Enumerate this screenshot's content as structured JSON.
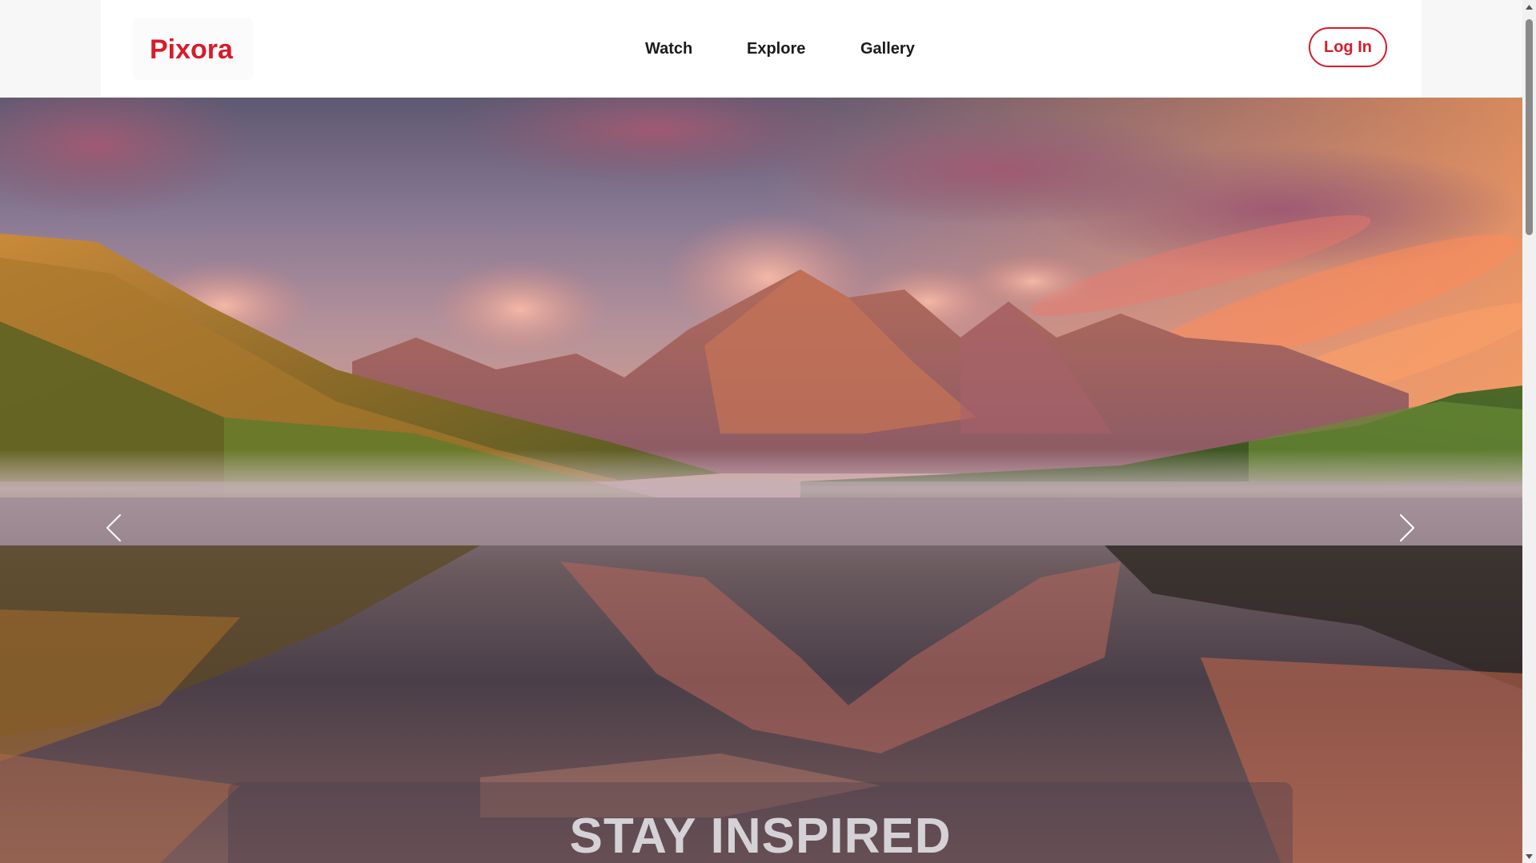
{
  "brand": {
    "name": "Pixora",
    "logo_color": "#d81b2a"
  },
  "nav": {
    "items": [
      {
        "label": "Watch"
      },
      {
        "label": "Explore"
      },
      {
        "label": "Gallery"
      }
    ],
    "login_label": "Log In"
  },
  "hero": {
    "caption_title": "STAY INSPIRED",
    "prev_icon": "chevron-left-icon",
    "next_icon": "chevron-right-icon"
  },
  "colors": {
    "accent": "#d81b2a",
    "header_bg": "#ffffff",
    "nav_text": "#1a1a1a"
  }
}
